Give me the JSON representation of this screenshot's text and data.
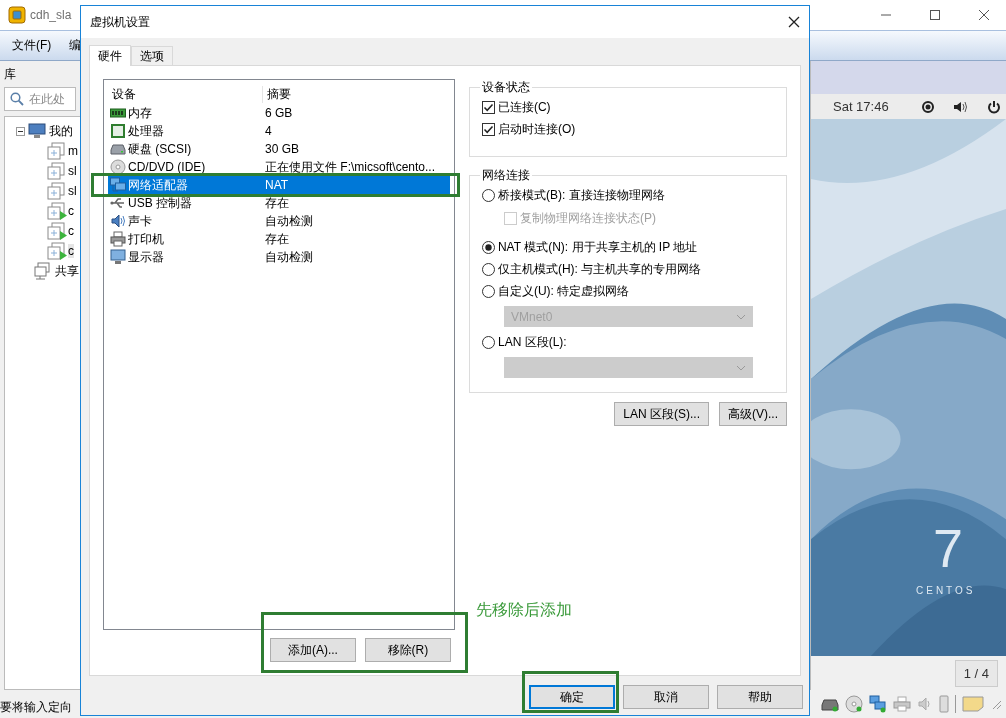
{
  "app_window": {
    "title": "cdh_sla",
    "menu": [
      "文件(F)",
      "编"
    ],
    "library_label": "库",
    "search": {
      "placeholder": "在此处"
    },
    "tree": [
      {
        "label": "我的",
        "children": [
          {
            "label": "m",
            "running": false,
            "selected": false
          },
          {
            "label": "sl",
            "running": false,
            "selected": false
          },
          {
            "label": "sl",
            "running": false,
            "selected": false
          },
          {
            "label": "c",
            "running": true,
            "selected": false
          },
          {
            "label": "c",
            "running": true,
            "selected": false
          },
          {
            "label": "c",
            "running": true,
            "selected": true
          }
        ]
      },
      {
        "label": "共享"
      }
    ],
    "status_text": "要将输入定向",
    "vm_console": {
      "clock": "Sat 17:46",
      "logo_number": "7",
      "logo_text": "CENTOS",
      "page": "1 / 4"
    }
  },
  "dialog": {
    "title": "虚拟机设置",
    "tabs": [
      {
        "label": "硬件",
        "selected": true
      },
      {
        "label": "选项",
        "selected": false
      }
    ],
    "devices": {
      "columns": [
        "设备",
        "摘要"
      ],
      "rows": [
        {
          "kind": "memory",
          "name": "内存",
          "summary": "6 GB",
          "selected": false
        },
        {
          "kind": "cpu",
          "name": "处理器",
          "summary": "4",
          "selected": false
        },
        {
          "kind": "disk",
          "name": "硬盘 (SCSI)",
          "summary": "30 GB",
          "selected": false
        },
        {
          "kind": "cdrom",
          "name": "CD/DVD (IDE)",
          "summary": "正在使用文件 F:\\micsoft\\cento...",
          "selected": false
        },
        {
          "kind": "network",
          "name": "网络适配器",
          "summary": "NAT",
          "selected": true
        },
        {
          "kind": "usb",
          "name": "USB 控制器",
          "summary": "存在",
          "selected": false
        },
        {
          "kind": "sound",
          "name": "声卡",
          "summary": "自动检测",
          "selected": false
        },
        {
          "kind": "printer",
          "name": "打印机",
          "summary": "存在",
          "selected": false
        },
        {
          "kind": "display",
          "name": "显示器",
          "summary": "自动检测",
          "selected": false
        }
      ]
    },
    "device_buttons": [
      "添加(A)...",
      "移除(R)"
    ],
    "device_status": {
      "title": "设备状态",
      "options": [
        {
          "label": "已连接(C)",
          "checked": true
        },
        {
          "label": "启动时连接(O)",
          "checked": true
        }
      ]
    },
    "network": {
      "title": "网络连接",
      "options": [
        {
          "kind": "radio",
          "label": "桥接模式(B): 直接连接物理网络",
          "selected": false
        },
        {
          "kind": "checkbox",
          "label": "复制物理网络连接状态(P)",
          "checked": false,
          "disabled": true
        },
        {
          "kind": "radio",
          "label": "NAT 模式(N): 用于共享主机的 IP 地址",
          "selected": true
        },
        {
          "kind": "radio",
          "label": "仅主机模式(H): 与主机共享的专用网络",
          "selected": false
        },
        {
          "kind": "radio",
          "label": "自定义(U): 特定虚拟网络",
          "selected": false
        },
        {
          "kind": "dropdown",
          "value": "VMnet0",
          "disabled": true
        },
        {
          "kind": "radio",
          "label": "LAN 区段(L):",
          "selected": false
        },
        {
          "kind": "dropdown",
          "disabled": true
        }
      ]
    },
    "network_buttons": [
      "LAN 区段(S)...",
      "高级(V)..."
    ],
    "footer_buttons": [
      {
        "label": "确定",
        "default": true
      },
      {
        "label": "取消",
        "default": false
      },
      {
        "label": "帮助",
        "default": false
      }
    ]
  },
  "annotation": {
    "note": "先移除后添加"
  }
}
